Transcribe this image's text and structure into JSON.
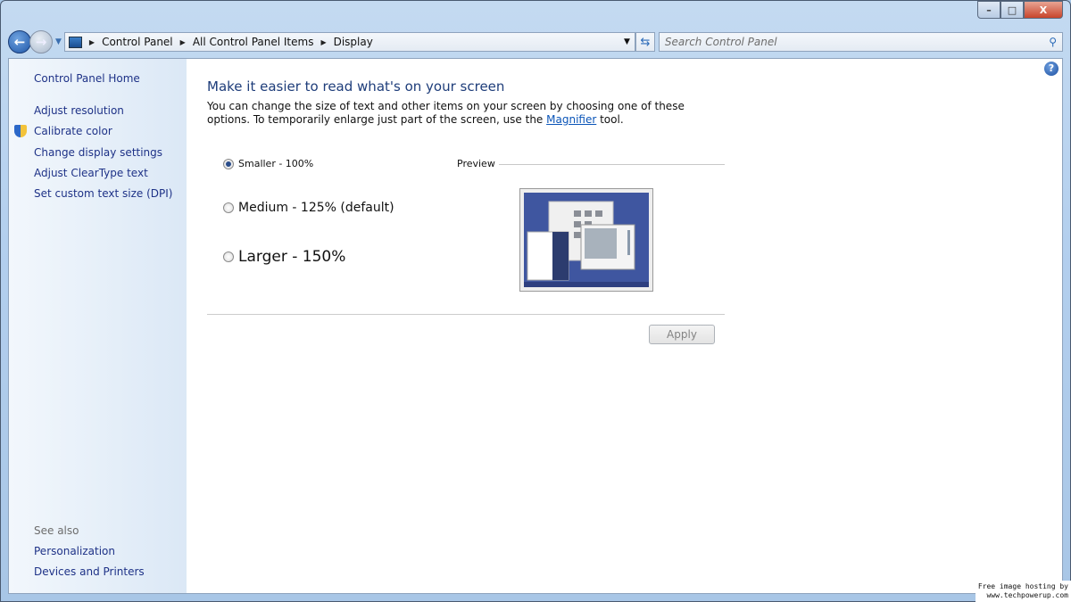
{
  "window": {
    "minimize": "–",
    "maximize": "□",
    "close": "X"
  },
  "address_bar": {
    "crumbs": [
      "Control Panel",
      "All Control Panel Items",
      "Display"
    ]
  },
  "search": {
    "placeholder": "Search Control Panel"
  },
  "sidebar": {
    "home": "Control Panel Home",
    "items": [
      {
        "label": "Adjust resolution"
      },
      {
        "label": "Calibrate color"
      },
      {
        "label": "Change display settings"
      },
      {
        "label": "Adjust ClearType text"
      },
      {
        "label": "Set custom text size (DPI)"
      }
    ],
    "see_also_label": "See also",
    "see_also": [
      {
        "label": "Personalization"
      },
      {
        "label": "Devices and Printers"
      }
    ]
  },
  "main": {
    "title": "Make it easier to read what's on your screen",
    "desc_before": "You can change the size of text and other items on your screen by choosing one of these options. To temporarily enlarge just part of the screen, use the ",
    "desc_link": "Magnifier",
    "desc_after": " tool.",
    "options": [
      {
        "label": "Smaller - 100%",
        "selected": true
      },
      {
        "label": "Medium - 125% (default)",
        "selected": false
      },
      {
        "label": "Larger - 150%",
        "selected": false
      }
    ],
    "preview_label": "Preview",
    "apply_label": "Apply"
  },
  "watermark": {
    "line1": "Free image hosting by",
    "line2": "www.techpowerup.com"
  }
}
